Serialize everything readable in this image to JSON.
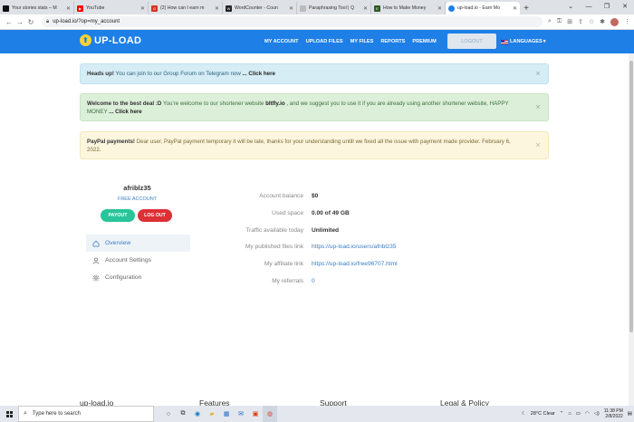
{
  "browser": {
    "tabs": [
      {
        "title": "Your stories stats – M",
        "fav_color": "#111111",
        "active": false
      },
      {
        "title": "YouTube",
        "fav_color": "#ff0000",
        "active": false
      },
      {
        "title": "(2) How can I earn m",
        "fav_color": "#d93025",
        "active": false
      },
      {
        "title": "WordCounter - Coun",
        "fav_color": "#222222",
        "active": false
      },
      {
        "title": "Paraphrasing Tool | Q",
        "fav_color": "#e8eaed",
        "active": false
      },
      {
        "title": "How to Make Money",
        "fav_color": "#2d5a27",
        "active": false
      },
      {
        "title": "up-load.io - Earn Mo",
        "fav_color": "#1e7fe6",
        "active": true
      }
    ],
    "url": "up-load.io/?op=my_account"
  },
  "site": {
    "logo": "UP-LOAD",
    "nav": [
      "MY ACCOUNT",
      "UPLOAD FILES",
      "MY FILES",
      "REPORTS",
      "PREMIUM"
    ],
    "logout": "LOGOUT",
    "languages": "LANGUAGES"
  },
  "alerts": {
    "a1": {
      "label": "Heads up!",
      "text": " You can join to our Group Forum on Telegram now ",
      "link": "... Click here"
    },
    "a2": {
      "label": "Welcome to the best deal :D",
      "text1": " You're welcome to our shortener website ",
      "brand": "bltfly.io",
      "text2": " , and we suggest you to use it if you are already using another shortener website, HAPPY MONEY ",
      "link": "... Click here"
    },
    "a3": {
      "label": "PayPal payments!",
      "text": " Dear user, PayPal payment temporary it will be late, thanks for your understanding untill we fixed all the issue with payment made provider. February 6, 2022."
    }
  },
  "profile": {
    "username": "afriblz35",
    "account_type": "FREE ACCOUNT",
    "payout": "PAYOUT",
    "logout": "LOG OUT",
    "menu": [
      "Overview",
      "Account Settings",
      "Configuration"
    ]
  },
  "account": [
    {
      "k": "Account balance",
      "v": "$0"
    },
    {
      "k": "Used space",
      "v": "0.00 of 49 GB"
    },
    {
      "k": "Traffic available today",
      "v": "Unlimited"
    },
    {
      "k": "My published files link",
      "v": "https://up-load.io/users/afriblz35"
    },
    {
      "k": "My affiliate link",
      "v": "https://up-load.io/free96707.html"
    },
    {
      "k": "My referrals",
      "v": "0"
    }
  ],
  "footer": [
    "up-load.io",
    "Features",
    "Support",
    "Legal & Policy"
  ],
  "taskbar": {
    "search_placeholder": "Type here to search",
    "weather": "28°C  Clear",
    "time": "11:38 PM",
    "date": "2/8/2022"
  }
}
